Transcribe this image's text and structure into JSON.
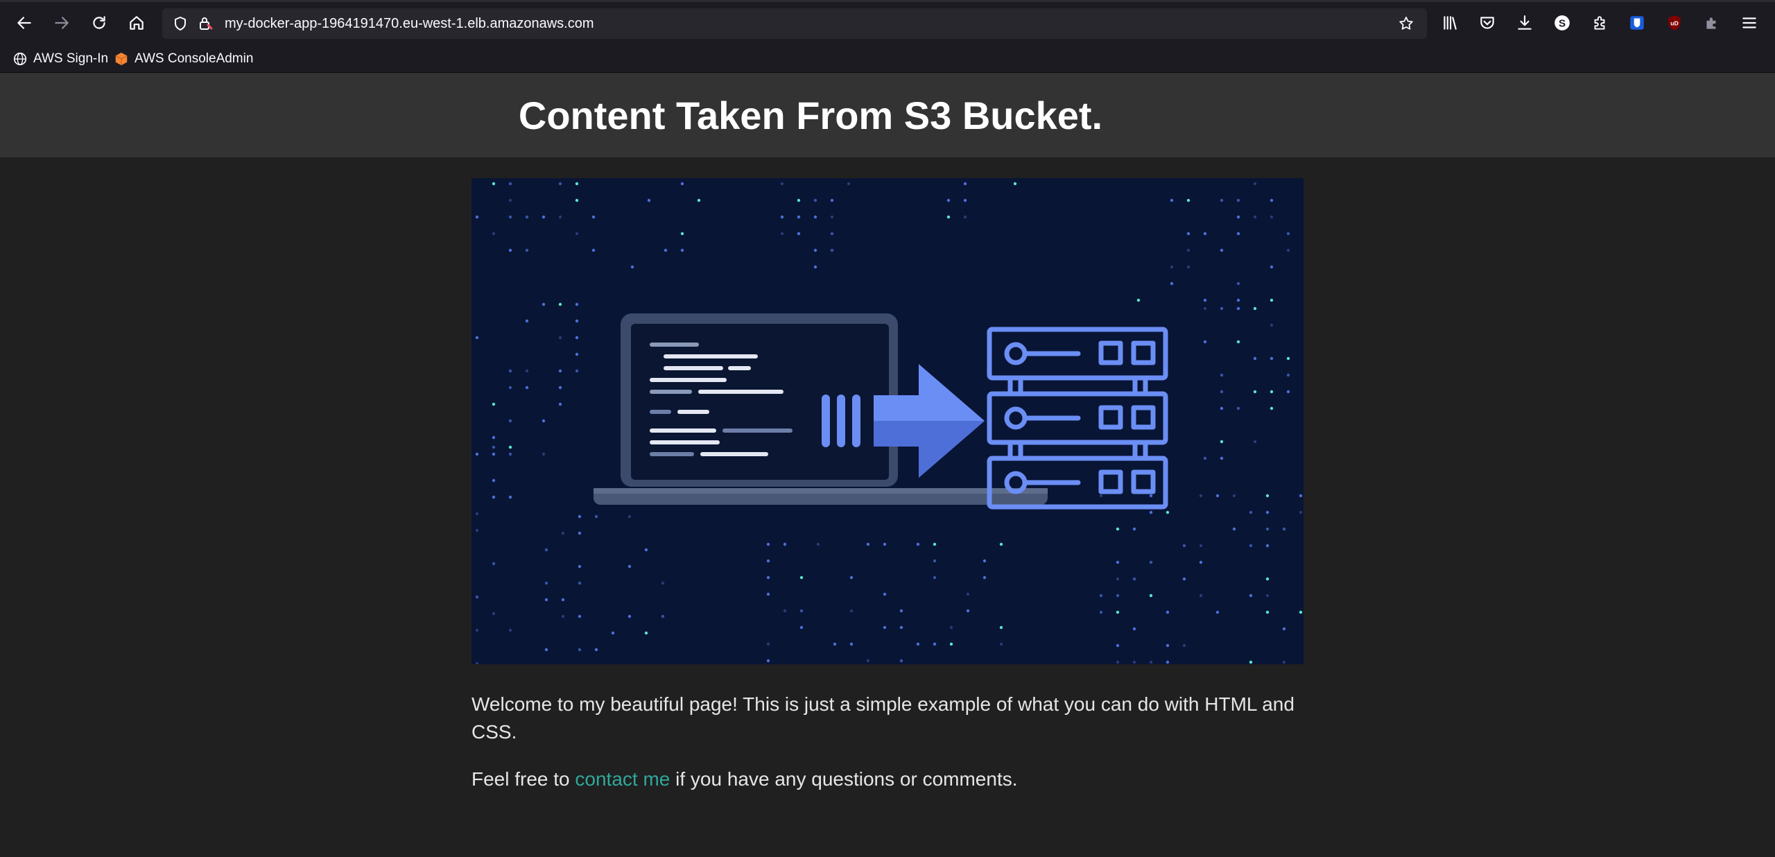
{
  "browser": {
    "url": "my-docker-app-1964191470.eu-west-1.elb.amazonaws.com",
    "bookmarks": [
      {
        "label": "AWS Sign-In",
        "icon": "globe-icon"
      },
      {
        "label": "AWS ConsoleAdmin",
        "icon": "aws-cube-icon"
      }
    ],
    "toolbar_icons": [
      "back-icon",
      "forward-icon",
      "reload-icon",
      "home-icon",
      "shield-icon",
      "lock-warning-icon",
      "star-icon",
      "library-icon",
      "pocket-icon",
      "download-icon",
      "account-icon",
      "extensions-icon",
      "bitwarden-icon",
      "ublock-icon",
      "puzzle-icon",
      "menu-icon"
    ]
  },
  "page": {
    "title": "Content Taken From S3 Bucket.",
    "hero_image": "laptop-to-server-illustration",
    "paragraph1": "Welcome to my beautiful page! This is just a simple example of what you can do with HTML and CSS.",
    "paragraph2_before": "Feel free to ",
    "paragraph2_link": "contact me",
    "paragraph2_after": " if you have any questions or comments."
  },
  "colors": {
    "page_background": "#202020",
    "header_background": "#333333",
    "hero_background": "#081535",
    "link": "#2fa89a",
    "accent_blue": "#6b8ef5"
  }
}
